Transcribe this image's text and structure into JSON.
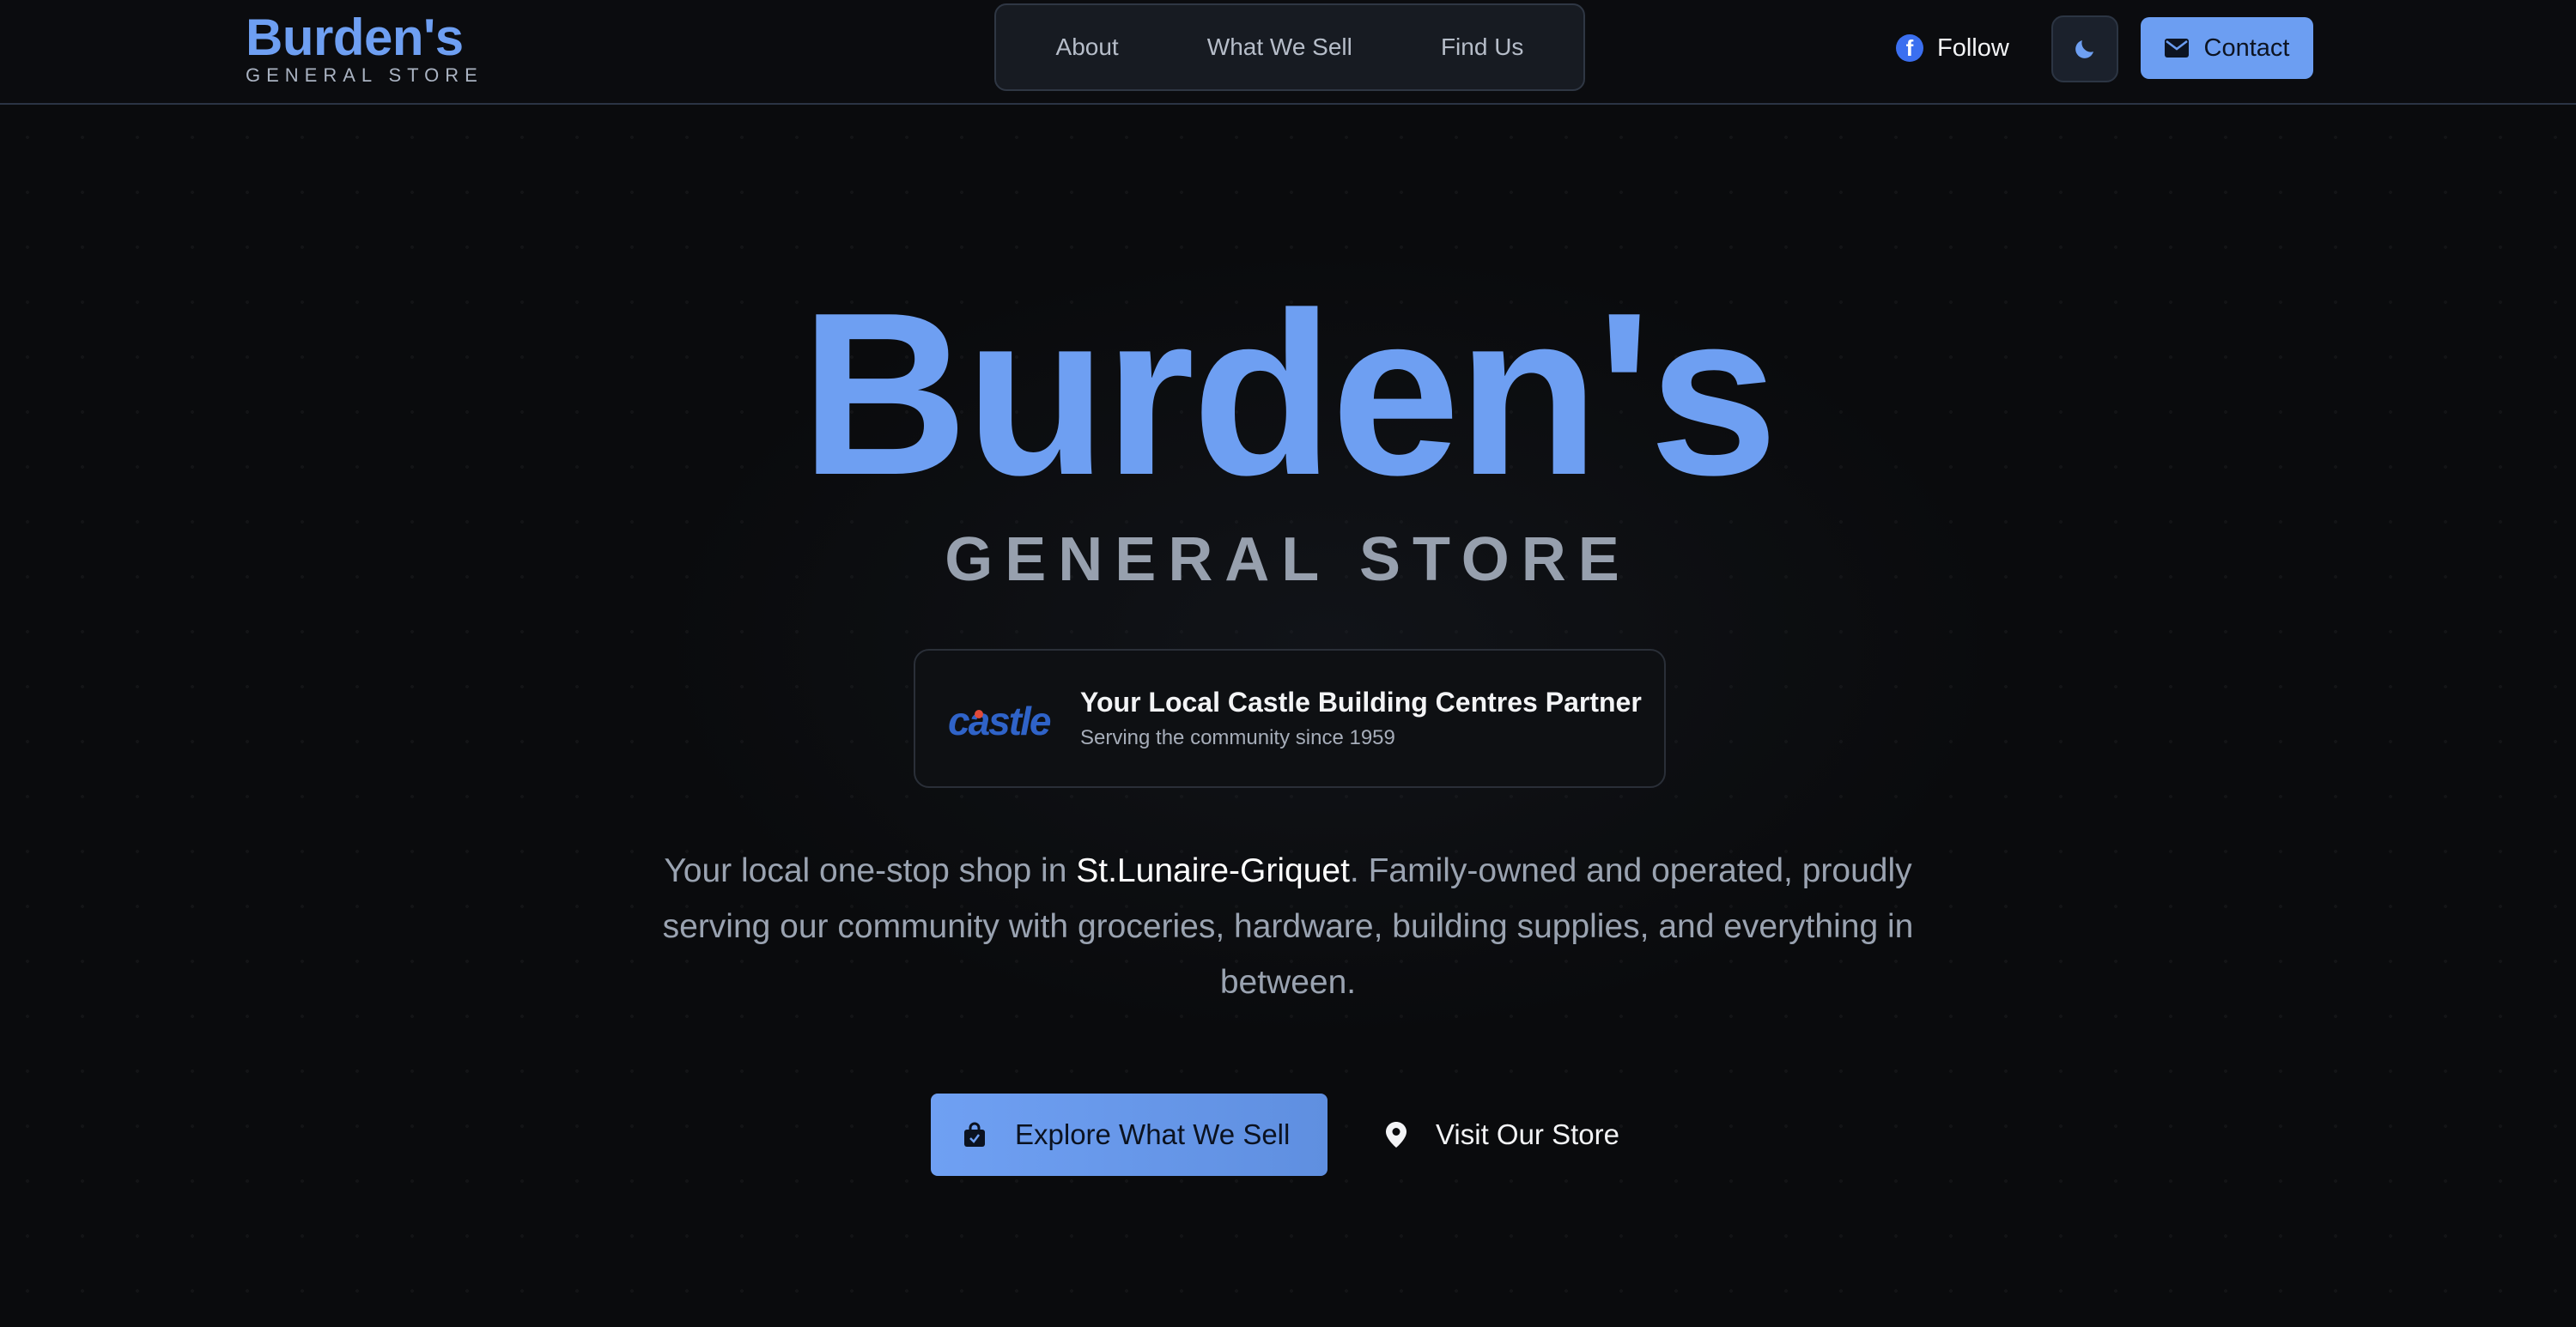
{
  "header": {
    "brand_name": "Burden's",
    "brand_sub": "GENERAL STORE",
    "nav": [
      {
        "label": "About"
      },
      {
        "label": "What We Sell"
      },
      {
        "label": "Find Us"
      }
    ],
    "follow_label": "Follow",
    "contact_label": "Contact"
  },
  "hero": {
    "title": "Burden's",
    "subtitle": "GENERAL STORE",
    "partner": {
      "logo_text": "castle",
      "title": "Your Local Castle Building Centres Partner",
      "subtitle": "Serving the community since 1959"
    },
    "description": {
      "before": "Your local one-stop shop in ",
      "highlight": "St.Lunaire-Griquet",
      "after": ". Family-owned and operated, proudly serving our community with groceries, hardware, building supplies, and everything in between."
    },
    "explore_label": "Explore What We Sell",
    "visit_label": "Visit Our Store"
  },
  "icons": {
    "follow": "facebook-icon",
    "theme": "moon-icon",
    "contact": "envelope-icon",
    "explore": "shopping-bag-icon",
    "visit": "map-pin-icon"
  },
  "colors": {
    "background": "#0a0b0d",
    "accent": "#6e9ff2",
    "facebook": "#3b6ff0",
    "muted_text": "#9aa3b1"
  }
}
